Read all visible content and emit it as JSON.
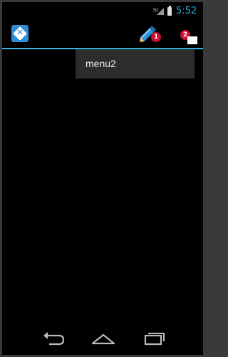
{
  "status_bar": {
    "network": "3G",
    "time": "5:52",
    "icons": [
      "signal-icon",
      "battery-icon"
    ]
  },
  "action_bar": {
    "app_icon": "xamarin-logo-icon",
    "actions": [
      {
        "icon": "pen-icon",
        "badge": "1"
      },
      {
        "icon": "document-icon",
        "badge": "2"
      }
    ]
  },
  "overflow_menu": {
    "items": [
      "menu2"
    ]
  },
  "nav_bar": {
    "buttons": [
      "back-icon",
      "home-icon",
      "recent-apps-icon"
    ]
  },
  "colors": {
    "accent": "#33b5e5",
    "time_text": "#2eaadc",
    "badge": "#c8102e",
    "menu_bg": "#2c2c2c",
    "app_icon": "#2f8fd6"
  }
}
